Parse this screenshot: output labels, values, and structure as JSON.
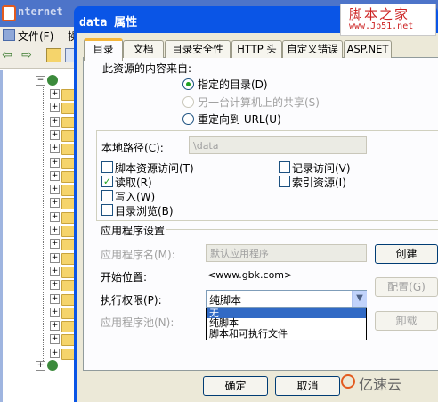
{
  "background_window": {
    "title": "nternet",
    "menu": {
      "file": "文件(F)",
      "action": "操"
    }
  },
  "dialog": {
    "title": "data 属性",
    "tabs": [
      {
        "label": "目录",
        "active": true
      },
      {
        "label": "文档"
      },
      {
        "label": "目录安全性"
      },
      {
        "label": "HTTP 头"
      },
      {
        "label": "自定义错误"
      },
      {
        "label": "ASP.NET"
      }
    ],
    "source_label": "此资源的内容来自:",
    "source_options": [
      {
        "label": "指定的目录(D)",
        "selected": true,
        "enabled": true
      },
      {
        "label": "另一台计算机上的共享(S)",
        "selected": false,
        "enabled": false
      },
      {
        "label": "重定向到 URL(U)",
        "selected": false,
        "enabled": true
      }
    ],
    "local_path_label": "本地路径(C):",
    "local_path_value": "\\data",
    "checkboxes": {
      "script_source_access": {
        "label": "脚本资源访问(T)",
        "checked": false
      },
      "read": {
        "label": "读取(R)",
        "checked": true
      },
      "write": {
        "label": "写入(W)",
        "checked": false
      },
      "directory_browsing": {
        "label": "目录浏览(B)",
        "checked": false
      },
      "log_visits": {
        "label": "记录访问(V)",
        "checked": false
      },
      "index_resource": {
        "label": "索引资源(I)",
        "checked": false
      }
    },
    "app_settings_label": "应用程序设置",
    "app_name_label": "应用程序名(M):",
    "app_name_value": "默认应用程序",
    "create_button": "创建",
    "start_position_label": "开始位置:",
    "start_position_value": "<www.gbk.com>",
    "config_button": "配置(G)",
    "exec_permission_label": "执行权限(P):",
    "exec_permission_value": "纯脚本",
    "exec_permission_options": [
      "无",
      "纯脚本",
      "脚本和可执行文件"
    ],
    "exec_permission_highlighted": "无",
    "app_pool_label": "应用程序池(N):",
    "unload_button": "卸载",
    "ok_button": "确定",
    "cancel_button": "取消"
  },
  "watermarks": {
    "logo_main": "脚本之家",
    "logo_url": "www.Jb51.net",
    "brand": "亿速云"
  },
  "colors": {
    "dialog_title_bar": "#0a55e6",
    "dialog_body": "#ece9d8",
    "tab_active_accent": "#f4b63b",
    "radio_selected": "#21a121",
    "dropdown_highlight": "#316ac5"
  }
}
